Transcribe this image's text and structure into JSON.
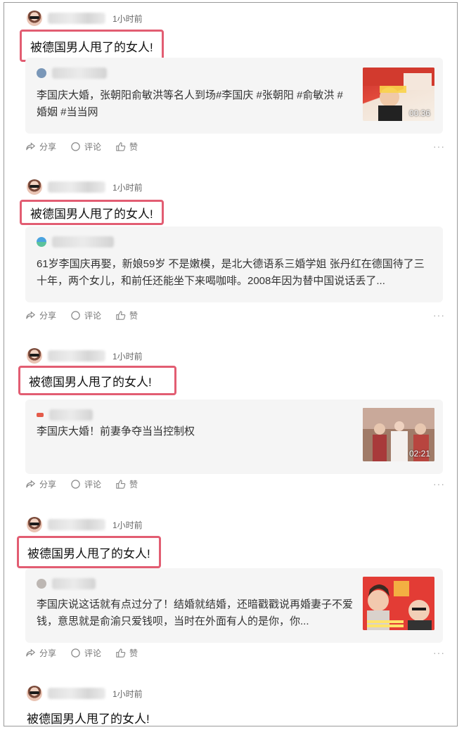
{
  "posts": [
    {
      "time": "1小时前",
      "title": "被德国男人甩了的女人!",
      "card_text": "李国庆大婚，张朝阳俞敏洪等名人到场#李国庆 #张朝阳 #俞敏洪 #婚姻 #当当网",
      "thumb_type": "video",
      "duration": "00:36",
      "share": "分享",
      "comment": "评论",
      "like": "赞",
      "more": "···"
    },
    {
      "time": "1小时前",
      "title": "被德国男人甩了的女人!",
      "card_text": "61岁李国庆再娶，新娘59岁 不是嫩模，是北大德语系三婚学姐 张丹红在德国待了三十年，两个女儿，和前任还能坐下来喝咖啡。2008年因为替中国说话丢了...",
      "thumb_type": "none",
      "share": "分享",
      "comment": "评论",
      "like": "赞",
      "more": "···"
    },
    {
      "time": "1小时前",
      "title": "被德国男人甩了的女人!",
      "card_text": "李国庆大婚！前妻争夺当当控制权",
      "thumb_type": "video",
      "duration": "02:21",
      "share": "分享",
      "comment": "评论",
      "like": "赞",
      "more": "···"
    },
    {
      "time": "1小时前",
      "title": "被德国男人甩了的女人!",
      "card_text": "李国庆说这话就有点过分了！结婚就结婚，还暗戳戳说再婚妻子不爱钱，意思就是俞渝只爱钱呗，当时在外面有人的是你，你...",
      "thumb_type": "image",
      "share": "分享",
      "comment": "评论",
      "like": "赞",
      "more": "···"
    },
    {
      "time": "1小时前",
      "title": "被德国男人甩了的女人!"
    }
  ],
  "colors": {
    "highlight_border": "#e25d72",
    "card_bg": "#f5f5f5",
    "meta_text": "#777777"
  },
  "icons": [
    "share-icon",
    "comment-icon",
    "like-icon",
    "more-icon"
  ]
}
